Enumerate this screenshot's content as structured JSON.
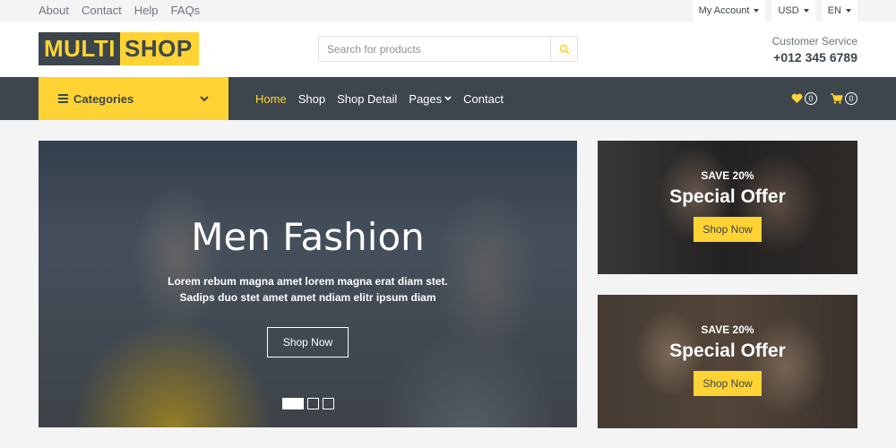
{
  "topbar": {
    "links": [
      "About",
      "Contact",
      "Help",
      "FAQs"
    ],
    "account": "My Account",
    "currency": "USD",
    "language": "EN"
  },
  "header": {
    "logo_part1": "MULTI",
    "logo_part2": "SHOP",
    "search_placeholder": "Search for products",
    "service_label": "Customer Service",
    "service_phone": "+012 345 6789"
  },
  "nav": {
    "categories_label": "Categories",
    "links": [
      "Home",
      "Shop",
      "Shop Detail",
      "Pages",
      "Contact"
    ],
    "active": "Home",
    "wishlist_count": "0",
    "cart_count": "0"
  },
  "hero": {
    "title": "Men Fashion",
    "text": "Lorem rebum magna amet lorem magna erat diam stet. Sadips duo stet amet amet ndiam elitr ipsum diam",
    "button": "Shop Now",
    "slides": 3,
    "active_slide": 1
  },
  "offers": [
    {
      "save": "SAVE 20%",
      "title": "Special Offer",
      "button": "Shop Now"
    },
    {
      "save": "SAVE 20%",
      "title": "Special Offer",
      "button": "Shop Now"
    }
  ],
  "colors": {
    "primary": "#ffd333",
    "dark": "#3d464d",
    "background": "#f4f4f5"
  },
  "icons": {
    "search": "search-icon",
    "menu": "bars-icon",
    "wishlist": "heart-icon",
    "cart": "shopping-cart-icon"
  }
}
